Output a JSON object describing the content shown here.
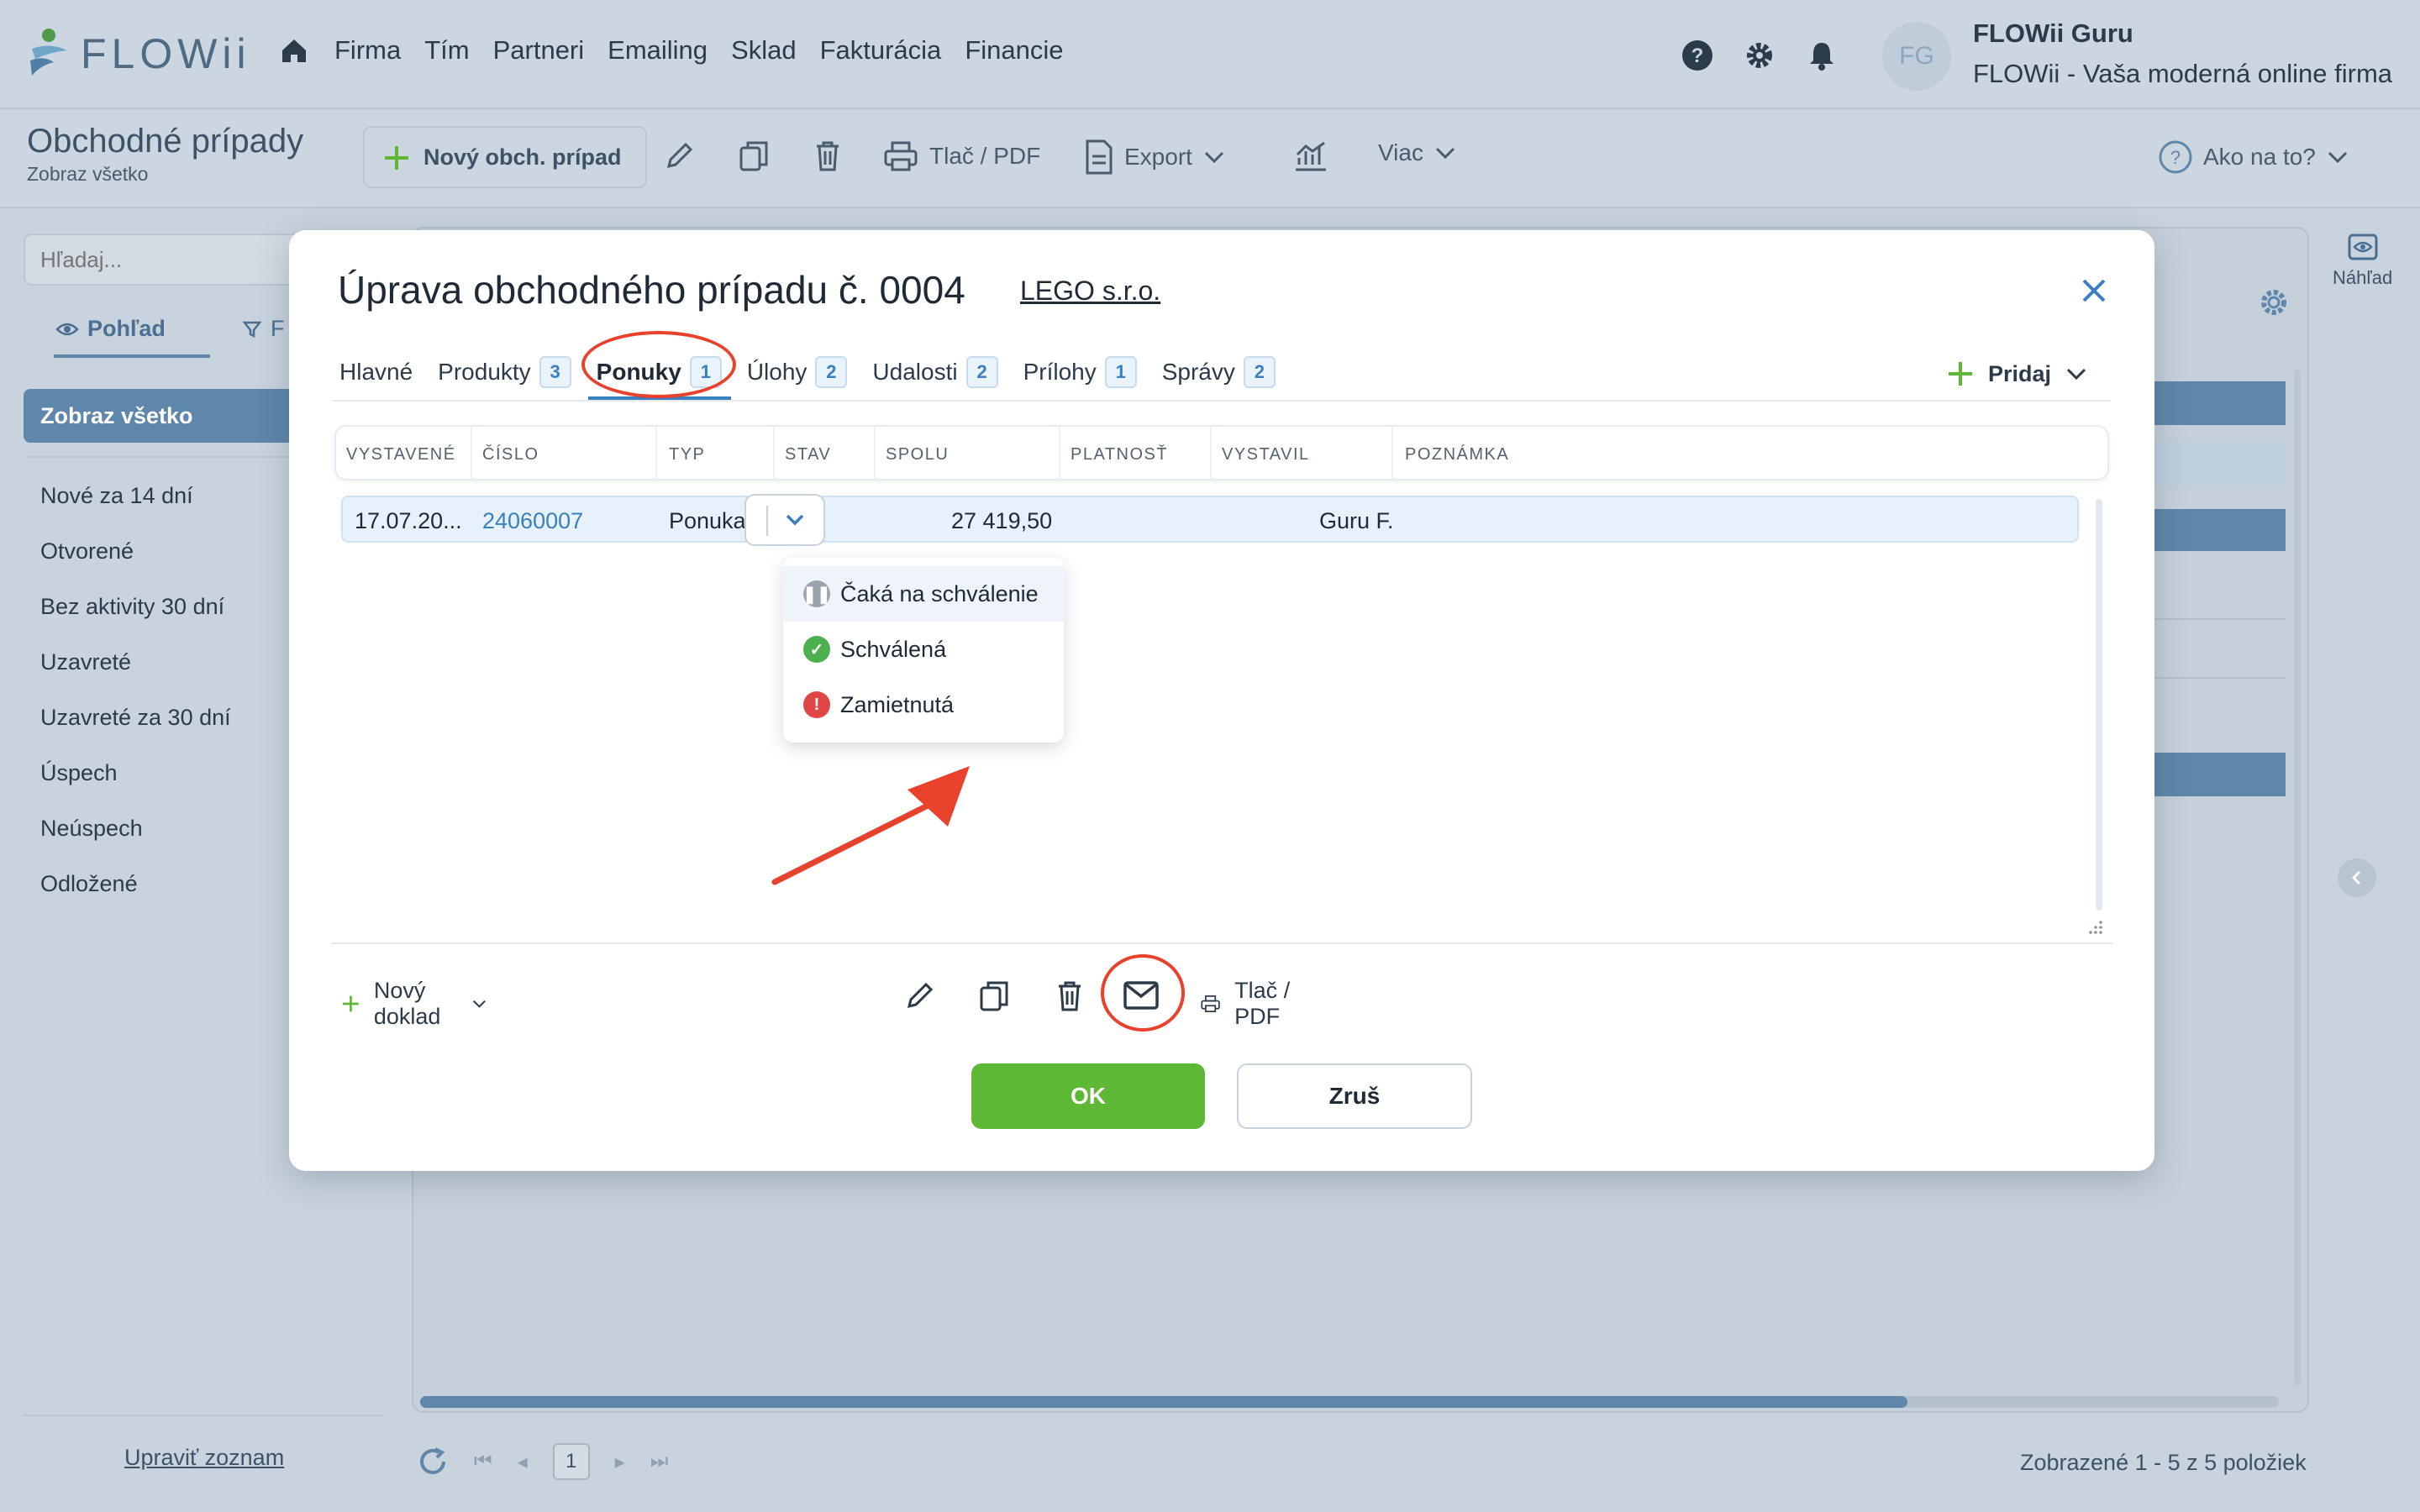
{
  "app": {
    "logo_text": "FLOWii"
  },
  "nav": {
    "items": [
      "Firma",
      "Tím",
      "Partneri",
      "Emailing",
      "Sklad",
      "Fakturácia",
      "Financie"
    ]
  },
  "user": {
    "initials": "FG",
    "name": "FLOWii Guru",
    "company": "FLOWii - Vaša moderná online firma"
  },
  "toolbar": {
    "page_title": "Obchodné prípady",
    "page_subtitle": "Zobraz všetko",
    "new_label": "Nový obch. prípad",
    "print_label": "Tlač / PDF",
    "export_label": "Export",
    "more_label": "Viac",
    "help_label": "Ako na to?"
  },
  "sidebar": {
    "search_placeholder": "Hľadaj...",
    "view_tab": "Pohľad",
    "filter_tab": "F",
    "active_item": "Zobraz všetko",
    "items": [
      "Nové za 14 dní",
      "Otvorené",
      "Bez aktivity 30 dní",
      "Uzavreté",
      "Uzavreté za 30 dní",
      "Úspech",
      "Neúspech",
      "Odložené"
    ],
    "edit_list": "Upraviť zoznam"
  },
  "background": {
    "preview_label": "Náhľad",
    "current_page": "1",
    "count_text": "Zobrazené 1 - 5 z 5 položiek"
  },
  "modal": {
    "title": "Úprava obchodného prípadu č. 0004",
    "company": "LEGO s.r.o.",
    "tabs": [
      {
        "label": "Hlavné",
        "badge": ""
      },
      {
        "label": "Produkty",
        "badge": "3"
      },
      {
        "label": "Ponuky",
        "badge": "1"
      },
      {
        "label": "Úlohy",
        "badge": "2"
      },
      {
        "label": "Udalosti",
        "badge": "2"
      },
      {
        "label": "Prílohy",
        "badge": "1"
      },
      {
        "label": "Správy",
        "badge": "2"
      }
    ],
    "add_label": "Pridaj",
    "columns": [
      "VYSTAVENÉ",
      "ČÍSLO",
      "TYP",
      "STAV",
      "SPOLU",
      "PLATNOSŤ",
      "VYSTAVIL",
      "POZNÁMKA"
    ],
    "row": {
      "issued": "17.07.20...",
      "number": "24060007",
      "type": "Ponuka",
      "total": "27 419,50",
      "issued_by": "Guru F."
    },
    "status_options": [
      {
        "label": "Čaká na schválenie",
        "color": "#9aa4ad"
      },
      {
        "label": "Schválená",
        "color": "#4cb04f"
      },
      {
        "label": "Zamietnutá",
        "color": "#e04646"
      }
    ],
    "bottom": {
      "new_doc": "Nový doklad",
      "print": "Tlač / PDF"
    },
    "ok_label": "OK",
    "cancel_label": "Zruš"
  },
  "colors": {
    "accent": "#3a7fc0",
    "ok": "#5fb736",
    "annotation": "#e8412c",
    "sidebar_active": "#5f86ab"
  }
}
